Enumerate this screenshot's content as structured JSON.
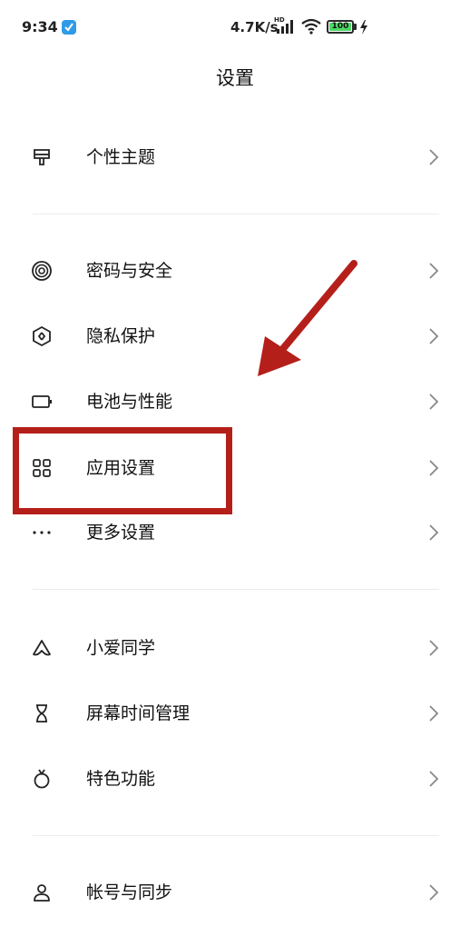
{
  "status_bar": {
    "time": "9:34",
    "network_speed": "4.7K/s",
    "hd_label": "HD",
    "battery": "100"
  },
  "title": "设置",
  "items": [
    {
      "label": "个性主题",
      "icon": "theme-icon"
    },
    {
      "label": "密码与安全",
      "icon": "fingerprint-icon"
    },
    {
      "label": "隐私保护",
      "icon": "privacy-icon"
    },
    {
      "label": "电池与性能",
      "icon": "battery-icon"
    },
    {
      "label": "应用设置",
      "icon": "apps-grid-icon"
    },
    {
      "label": "更多设置",
      "icon": "more-icon"
    },
    {
      "label": "小爱同学",
      "icon": "xiaoai-icon"
    },
    {
      "label": "屏幕时间管理",
      "icon": "hourglass-icon"
    },
    {
      "label": "特色功能",
      "icon": "feature-icon"
    },
    {
      "label": "帐号与同步",
      "icon": "account-icon"
    }
  ],
  "annotation": {
    "color": "#b51f1a",
    "highlighted_item": "应用设置"
  }
}
